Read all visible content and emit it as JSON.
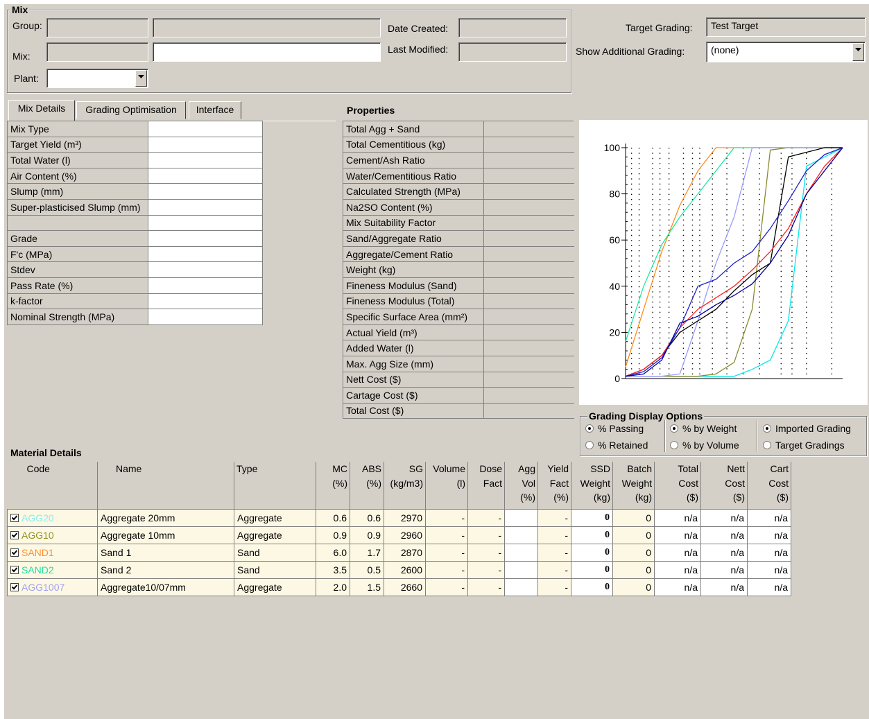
{
  "mix_group": {
    "title": "Mix",
    "group_label": "Group:",
    "group_value": "",
    "group_name": "",
    "mix_label": "Mix:",
    "mix_value": "",
    "mix_name": "",
    "plant_label": "Plant:",
    "plant_value": "",
    "date_created_label": "Date Created:",
    "date_created_value": "",
    "last_modified_label": "Last Modified:",
    "last_modified_value": ""
  },
  "target": {
    "target_grading_label": "Target Grading:",
    "target_grading_value": "Test Target",
    "show_additional_label": "Show Additional Grading:",
    "show_additional_value": "(none)"
  },
  "tabs": [
    "Mix Details",
    "Grading Optimisation",
    "Interface"
  ],
  "mix_details": [
    {
      "label": "Mix Type",
      "value": ""
    },
    {
      "label": "Target Yield (m³)",
      "value": ""
    },
    {
      "label": "Total Water (l)",
      "value": ""
    },
    {
      "label": "Air Content (%)",
      "value": ""
    },
    {
      "label": "Slump (mm)",
      "value": ""
    },
    {
      "label": "Super-plasticised Slump (mm)",
      "value": ""
    },
    {
      "label": "",
      "value": ""
    },
    {
      "label": "Grade",
      "value": ""
    },
    {
      "label": "F'c (MPa)",
      "value": ""
    },
    {
      "label": "Stdev",
      "value": ""
    },
    {
      "label": "Pass Rate (%)",
      "value": ""
    },
    {
      "label": "k-factor",
      "value": ""
    },
    {
      "label": "Nominal Strength (MPa)",
      "value": ""
    }
  ],
  "properties": {
    "title": "Properties",
    "rows": [
      {
        "label": "Total Agg + Sand",
        "value": ""
      },
      {
        "label": "Total Cementitious (kg)",
        "value": ""
      },
      {
        "label": "Cement/Ash Ratio",
        "value": ""
      },
      {
        "label": "Water/Cementitious Ratio",
        "value": ""
      },
      {
        "label": "Calculated Strength (MPa)",
        "value": ""
      },
      {
        "label": "Na2SO Content (%)",
        "value": ""
      },
      {
        "label": "Mix Suitability Factor",
        "value": ""
      },
      {
        "label": "Sand/Aggregate Ratio",
        "value": ""
      },
      {
        "label": "Aggregate/Cement Ratio",
        "value": ""
      },
      {
        "label": "Weight (kg)",
        "value": ""
      },
      {
        "label": "Fineness Modulus (Sand)",
        "value": ""
      },
      {
        "label": "Fineness Modulus (Total)",
        "value": ""
      },
      {
        "label": "Specific Surface Area (mm²)",
        "value": ""
      },
      {
        "label": "Actual Yield (m³)",
        "value": ""
      },
      {
        "label": "Added Water (l)",
        "value": ""
      },
      {
        "label": "Max. Agg Size (mm)",
        "value": ""
      },
      {
        "label": "Nett Cost ($)",
        "value": ""
      },
      {
        "label": "Cartage Cost ($)",
        "value": ""
      },
      {
        "label": "Total Cost ($)",
        "value": ""
      }
    ]
  },
  "grading_options": {
    "title": "Grading Display Options",
    "passing": "% Passing",
    "retained": "% Retained",
    "by_weight": "% by Weight",
    "by_volume": "% by Volume",
    "imported": "Imported Grading",
    "target": "Target Gradings"
  },
  "chart_data": {
    "type": "line",
    "ylim": [
      0,
      100
    ],
    "yticks": [
      "100",
      "80",
      "60",
      "40",
      "20",
      "0"
    ],
    "x": [
      0,
      1,
      2,
      3,
      4,
      5,
      6,
      7,
      8,
      9,
      10,
      11,
      12
    ],
    "series": [
      {
        "color": "#00e8e8",
        "values": [
          1,
          1,
          1,
          1,
          1,
          1,
          1,
          4,
          8,
          25,
          92,
          96,
          100
        ]
      },
      {
        "color": "#8a8a30",
        "values": [
          1,
          1,
          1,
          1,
          1,
          2,
          7,
          30,
          99,
          100,
          100,
          100,
          100
        ]
      },
      {
        "color": "#ff8c1a",
        "values": [
          5,
          30,
          55,
          75,
          90,
          100,
          100,
          100,
          100,
          100,
          100,
          100,
          100
        ]
      },
      {
        "color": "#20e8a0",
        "values": [
          16,
          40,
          58,
          70,
          80,
          90,
          100,
          100,
          100,
          100,
          100,
          100,
          100
        ]
      },
      {
        "color": "#9a9aff",
        "values": [
          1,
          1,
          1,
          2,
          25,
          50,
          70,
          100,
          100,
          100,
          100,
          100,
          100
        ]
      },
      {
        "color": "#000000",
        "values": [
          1,
          4,
          10,
          20,
          25,
          30,
          38,
          45,
          50,
          96,
          98,
          100,
          100
        ]
      },
      {
        "color": "#ff2020",
        "values": [
          1,
          4,
          10,
          22,
          30,
          35,
          40,
          47,
          55,
          65,
          80,
          92,
          100
        ]
      },
      {
        "color": "#2020c8",
        "values": [
          1,
          3,
          9,
          22,
          40,
          43,
          50,
          55,
          65,
          77,
          90,
          97,
          100
        ]
      },
      {
        "color": "#0000a0",
        "values": [
          1,
          2,
          8,
          24,
          27,
          32,
          36,
          41,
          50,
          62,
          80,
          90,
          100
        ]
      }
    ]
  },
  "material": {
    "title": "Material Details",
    "headers": [
      "Code",
      "Name",
      "Type",
      "MC\n(%)",
      "ABS\n(%)",
      "SG\n(kg/m3)",
      "Volume\n(l)",
      "Dose\nFact",
      "Agg\nVol\n(%)",
      "Yield\nFact\n(%)",
      "SSD\nWeight\n(kg)",
      "Batch\nWeight\n(kg)",
      "Total\nCost\n($)",
      "Nett\nCost\n($)",
      "Cart\nCost\n($)"
    ],
    "rows": [
      {
        "code": "AGG20",
        "code_color": "#80f0f0",
        "name": "Aggregate 20mm",
        "type": "Aggregate",
        "mc": "0.6",
        "abs": "0.6",
        "sg": "2970",
        "volume": "-",
        "dose": "-",
        "aggvol": "",
        "yield": "-",
        "ssd": "0",
        "batch": "0",
        "total": "n/a",
        "nett": "n/a",
        "cart": "n/a"
      },
      {
        "code": "AGG10",
        "code_color": "#909020",
        "name": "Aggregate 10mm",
        "type": "Aggregate",
        "mc": "0.9",
        "abs": "0.9",
        "sg": "2960",
        "volume": "-",
        "dose": "-",
        "aggvol": "",
        "yield": "-",
        "ssd": "0",
        "batch": "0",
        "total": "n/a",
        "nett": "n/a",
        "cart": "n/a"
      },
      {
        "code": "SAND1",
        "code_color": "#ff9030",
        "name": "Sand 1",
        "type": "Sand",
        "mc": "6.0",
        "abs": "1.7",
        "sg": "2870",
        "volume": "-",
        "dose": "-",
        "aggvol": "",
        "yield": "-",
        "ssd": "0",
        "batch": "0",
        "total": "n/a",
        "nett": "n/a",
        "cart": "n/a"
      },
      {
        "code": "SAND2",
        "code_color": "#20e0a0",
        "name": "Sand 2",
        "type": "Sand",
        "mc": "3.5",
        "abs": "0.5",
        "sg": "2600",
        "volume": "-",
        "dose": "-",
        "aggvol": "",
        "yield": "-",
        "ssd": "0",
        "batch": "0",
        "total": "n/a",
        "nett": "n/a",
        "cart": "n/a"
      },
      {
        "code": "AGG1007",
        "code_color": "#a0a0f0",
        "name": "Aggregate10/07mm",
        "type": "Aggregate",
        "mc": "2.0",
        "abs": "1.5",
        "sg": "2660",
        "volume": "-",
        "dose": "-",
        "aggvol": "",
        "yield": "-",
        "ssd": "0",
        "batch": "0",
        "total": "n/a",
        "nett": "n/a",
        "cart": "n/a"
      }
    ]
  }
}
